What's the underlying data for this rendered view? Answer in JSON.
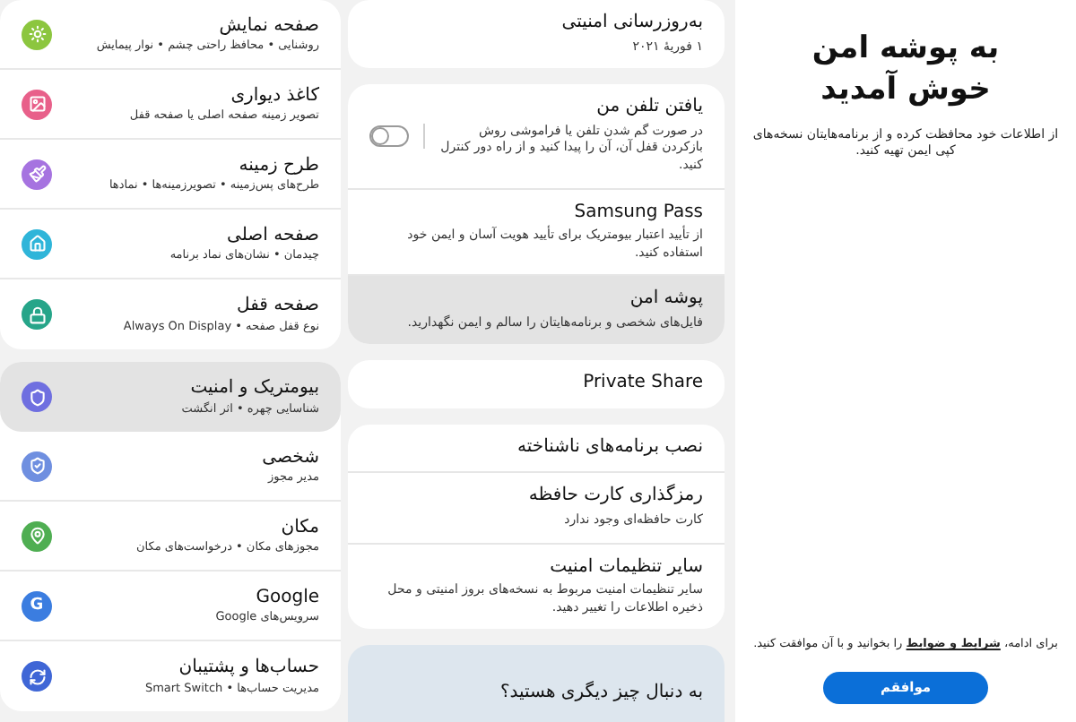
{
  "settings_list": {
    "groups": [
      {
        "items": [
          {
            "title": "صفحه نمایش",
            "subtitle": "روشنایی • محافظ راحتی چشم • نوار پیمایش",
            "color": "#8cc63f",
            "selected": false
          },
          {
            "title": "کاغذ دیواری",
            "subtitle": "تصویر زمینه صفحه اصلی یا صفحه قفل",
            "color": "#e8608a",
            "selected": false
          },
          {
            "title": "طرح زمینه",
            "subtitle": "طرح‌های پس‌زمینه • تصویرزمینه‌ها • نمادها",
            "color": "#a673e0",
            "selected": false
          },
          {
            "title": "صفحه اصلی",
            "subtitle": "چیدمان • نشان‌های نماد برنامه",
            "color": "#2fb5d9",
            "selected": false
          },
          {
            "title": "صفحه قفل",
            "subtitle": "نوع قفل صفحه • Always On Display",
            "color": "#26a589",
            "selected": false
          }
        ]
      },
      {
        "items": [
          {
            "title": "بیومتریک و امنیت",
            "subtitle": "شناسایی چهره • اثر انگشت",
            "color": "#6f6fe0",
            "selected": true
          },
          {
            "title": "شخصی",
            "subtitle": "مدیر مجوز",
            "color": "#6f8fe0",
            "selected": false
          },
          {
            "title": "مکان",
            "subtitle": "مجوزهای مکان • درخواست‌های مکان",
            "color": "#4fae52",
            "selected": false
          },
          {
            "title": "Google",
            "subtitle": "سرویس‌های Google",
            "color": "#3b7de0",
            "selected": false,
            "badge": "G"
          },
          {
            "title": "حساب‌ها و پشتیبان",
            "subtitle": "مدیریت حساب‌ها • Smart Switch",
            "color": "#3f66d6",
            "selected": false
          }
        ]
      }
    ]
  },
  "security": {
    "cards": [
      {
        "items": [
          {
            "kind": "text",
            "title": "به‌روزرسانی امنیتی",
            "subtitle": "۱ فوریهٔ ۲۰۲۱",
            "selected": false
          }
        ]
      },
      {
        "items": [
          {
            "kind": "toggle",
            "title": "یافتن تلفن من",
            "subtitle": "در صورت گم شدن تلفن یا فراموشی روش بازکردن قفل آن، آن را پیدا کنید و از راه دور کنترل کنید.",
            "on": false,
            "selected": false
          },
          {
            "kind": "text",
            "title": "Samsung Pass",
            "subtitle": "از تأیید اعتبار بیومتریک برای تأیید هویت آسان و ایمن خود استفاده کنید.",
            "selected": false
          },
          {
            "kind": "text",
            "title": "پوشه امن",
            "subtitle": "فایل‌های شخصی و برنامه‌هایتان را سالم و ایمن نگهدارید.",
            "selected": true
          }
        ]
      },
      {
        "items": [
          {
            "kind": "text",
            "title": "Private Share",
            "selected": false
          }
        ]
      },
      {
        "items": [
          {
            "kind": "text",
            "title": "نصب برنامه‌های ناشناخته",
            "selected": false
          },
          {
            "kind": "text",
            "title": "رمزگذاری کارت حافظه",
            "subtitle": "کارت حافظه‌ای وجود ندارد",
            "selected": false
          },
          {
            "kind": "text",
            "title": "سایر تنظیمات امنیت",
            "subtitle": "سایر تنظیمات امنیت مربوط به نسخه‌های بروز امنیتی و محل ذخیره اطلاعات را تغییر دهید.",
            "selected": false
          }
        ]
      }
    ],
    "help_card": {
      "title": "به دنبال چیز دیگری هستید؟"
    }
  },
  "secure_folder": {
    "title_lines": [
      "به پوشه امن",
      "خوش آمدید"
    ],
    "description": "از اطلاعات خود محافظت کرده و از برنامه‌هایتان نسخه‌های کپی ایمن تهیه کنید.",
    "terms": {
      "before": "برای ادامه،",
      "link": "شرایط و ضوابط",
      "after": "را بخوانید و با آن موافقت کنید."
    },
    "agree_button": "موافقم"
  }
}
